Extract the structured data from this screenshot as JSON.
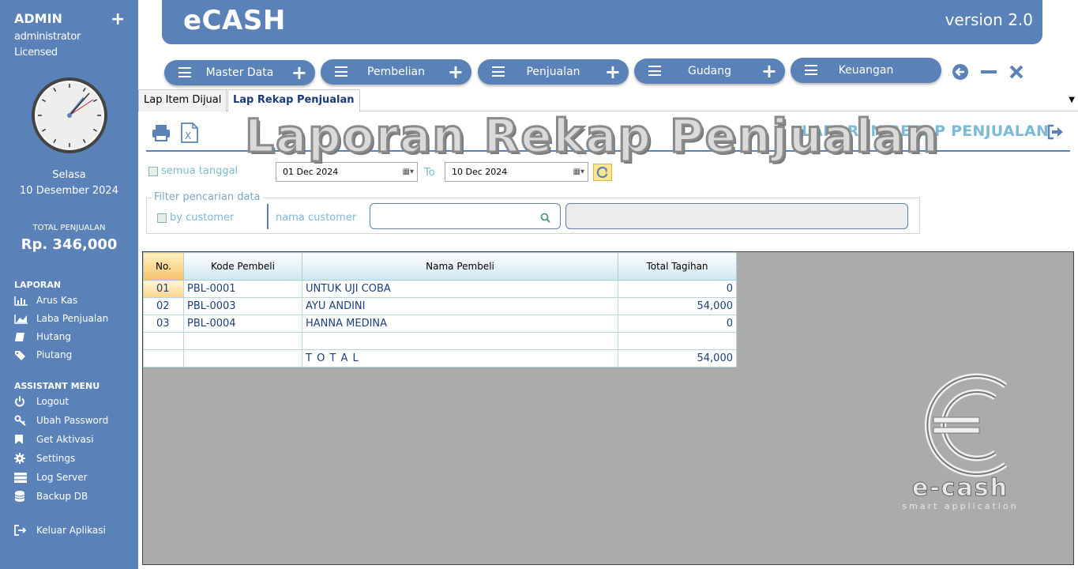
{
  "sidebar": {
    "user_name": "ADMIN",
    "role": "administrator",
    "license": "Licensed",
    "day": "Selasa",
    "date": "10 Desember 2024",
    "total_label": "TOTAL PENJUALAN",
    "total_value": "Rp. 346,000",
    "laporan_title": "LAPORAN",
    "laporan_items": [
      "Arus Kas",
      "Laba Penjualan",
      "Hutang",
      "Piutang"
    ],
    "assistant_title": "ASSISTANT MENU",
    "assistant_items": [
      "Logout",
      "Ubah Password",
      "Get Aktivasi",
      "Settings",
      "Log Server",
      "Backup DB"
    ],
    "exit_label": "Keluar Aplikasi"
  },
  "header": {
    "app_title": "eCASH",
    "version": "version 2.0"
  },
  "menu": [
    "Master Data",
    "Pembelian",
    "Penjualan",
    "Gudang",
    "Keuangan"
  ],
  "tabs": [
    "Lap Item Dijual",
    "Lap Rekap Penjualan"
  ],
  "report": {
    "title": "LAPORAN REKAP PENJUALAN",
    "watermark": "Laporan Rekap Penjualan",
    "semua_tanggal_label": "semua tanggal",
    "date_from": "01 Dec  2024",
    "to_label": "To",
    "date_to": "10 Dec  2024",
    "filter_legend": "Filter pencarian data",
    "by_customer_label": "by customer",
    "nama_customer_label": "nama customer",
    "search_value": ""
  },
  "table": {
    "columns": [
      "No.",
      "Kode Pembeli",
      "Nama Pembeli",
      "Total Tagihan"
    ],
    "rows": [
      {
        "no": "01",
        "kode": "PBL-0001",
        "nama": "UNTUK UJI COBA",
        "total": "0"
      },
      {
        "no": "02",
        "kode": "PBL-0003",
        "nama": "AYU ANDINI",
        "total": "54,000"
      },
      {
        "no": "03",
        "kode": "PBL-0004",
        "nama": "HANNA MEDINA",
        "total": "0"
      }
    ],
    "total_label": "T O T A L",
    "total_value": "54,000"
  },
  "logo": {
    "brand_text": "e-cash",
    "tagline": "smart application"
  }
}
